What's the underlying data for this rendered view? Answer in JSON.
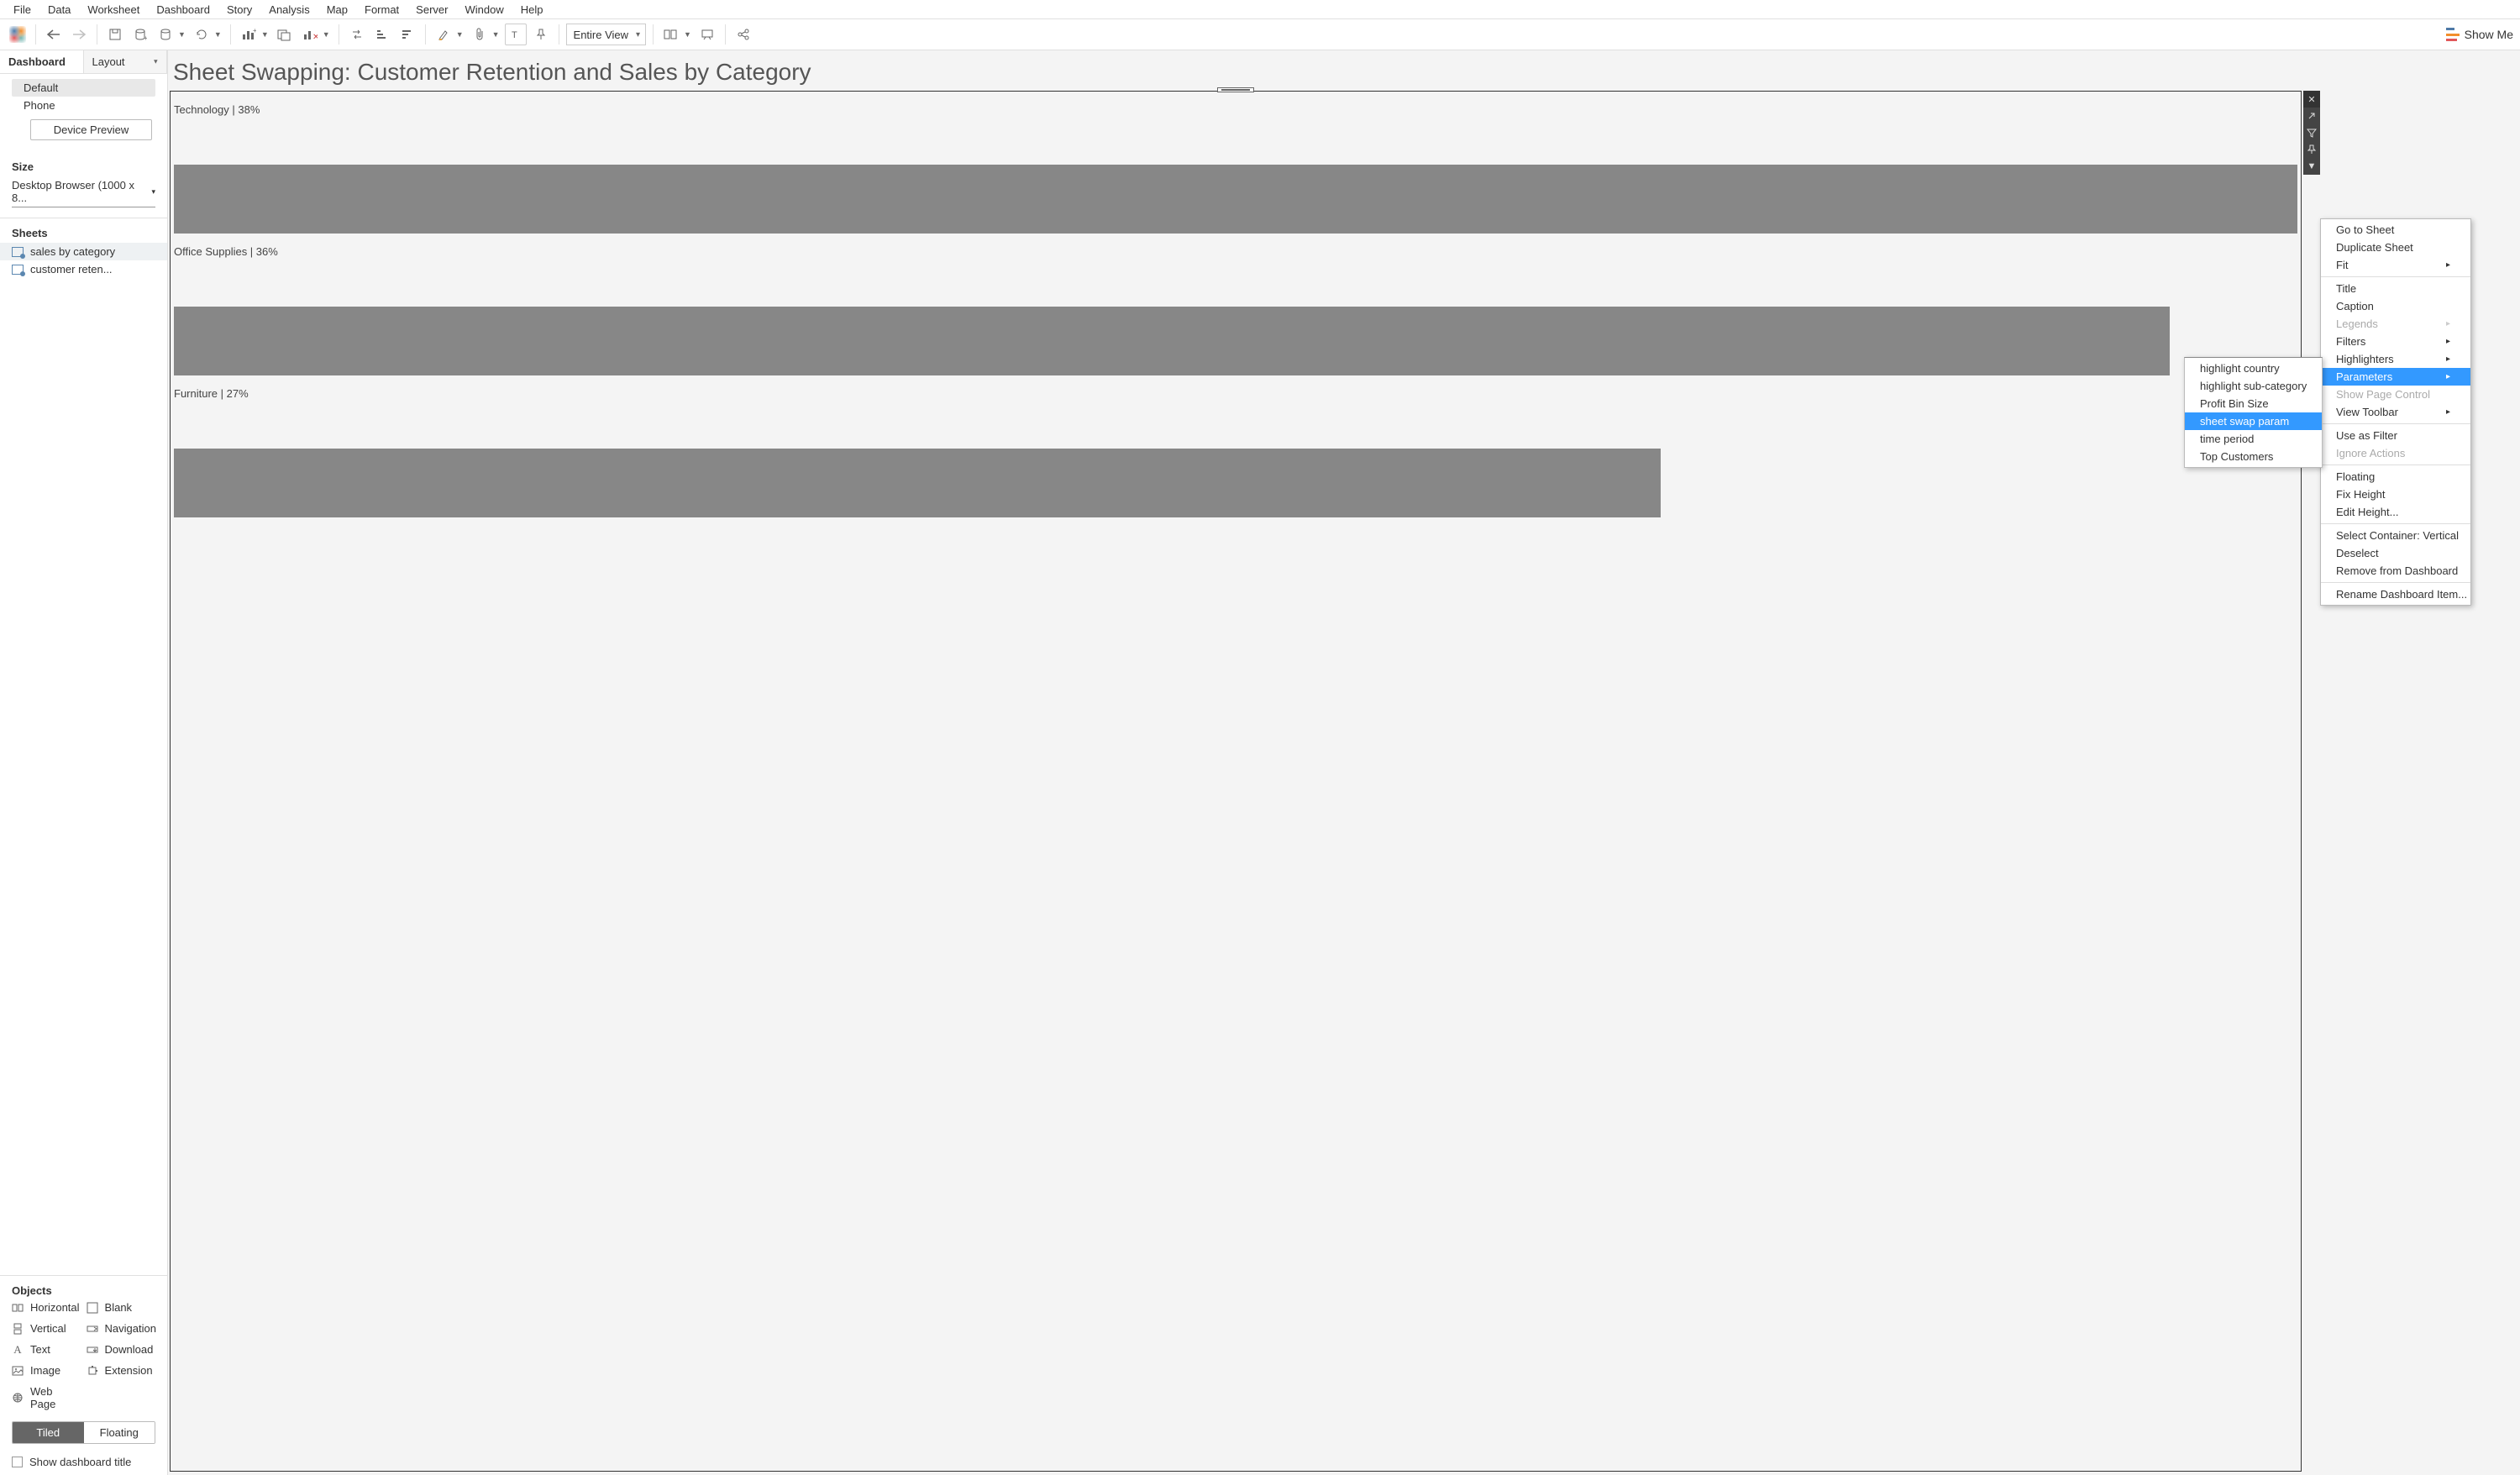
{
  "menu": [
    "File",
    "Data",
    "Worksheet",
    "Dashboard",
    "Story",
    "Analysis",
    "Map",
    "Format",
    "Server",
    "Window",
    "Help"
  ],
  "toolbar": {
    "fit_select": "Entire View",
    "showme": "Show Me"
  },
  "sidebar": {
    "tabs": {
      "dashboard": "Dashboard",
      "layout": "Layout"
    },
    "devices": {
      "default": "Default",
      "phone": "Phone",
      "preview_btn": "Device Preview"
    },
    "size": {
      "label": "Size",
      "value": "Desktop Browser (1000 x 8..."
    },
    "sheets": {
      "label": "Sheets",
      "items": [
        "sales by category",
        "customer reten..."
      ]
    },
    "objects": {
      "label": "Objects",
      "items": [
        "Horizontal",
        "Blank",
        "Vertical",
        "Navigation",
        "Text",
        "Download",
        "Image",
        "Extension",
        "Web Page"
      ]
    },
    "tile": {
      "tiled": "Tiled",
      "floating": "Floating"
    },
    "show_title": "Show dashboard title"
  },
  "canvas": {
    "title": "Sheet Swapping: Customer Retention and Sales by Category",
    "bars": [
      {
        "label": "Technology | 38%",
        "width": 100
      },
      {
        "label": "Office Supplies | 36%",
        "width": 94
      },
      {
        "label": "Furniture | 27%",
        "width": 70
      }
    ]
  },
  "chart_data": {
    "type": "bar",
    "title": "Sheet Swapping: Customer Retention and Sales by Category",
    "categories": [
      "Technology",
      "Office Supplies",
      "Furniture"
    ],
    "values": [
      38,
      36,
      27
    ],
    "unit": "%",
    "orientation": "horizontal"
  },
  "context_menu": {
    "items": [
      {
        "label": "Go to Sheet"
      },
      {
        "label": "Duplicate Sheet"
      },
      {
        "label": "Fit",
        "arrow": true
      },
      {
        "sep": true
      },
      {
        "label": "Title"
      },
      {
        "label": "Caption"
      },
      {
        "label": "Legends",
        "arrow": true,
        "disabled": true
      },
      {
        "label": "Filters",
        "arrow": true
      },
      {
        "label": "Highlighters",
        "arrow": true
      },
      {
        "label": "Parameters",
        "arrow": true,
        "highlight": true
      },
      {
        "label": "Show Page Control",
        "disabled": true
      },
      {
        "label": "View Toolbar",
        "arrow": true
      },
      {
        "sep": true
      },
      {
        "label": "Use as Filter"
      },
      {
        "label": "Ignore Actions",
        "disabled": true
      },
      {
        "sep": true
      },
      {
        "label": "Floating"
      },
      {
        "label": "Fix Height"
      },
      {
        "label": "Edit Height..."
      },
      {
        "sep": true
      },
      {
        "label": "Select Container: Vertical"
      },
      {
        "label": "Deselect"
      },
      {
        "label": "Remove from Dashboard"
      },
      {
        "sep": true
      },
      {
        "label": "Rename Dashboard Item..."
      }
    ]
  },
  "sub_menu": {
    "items": [
      {
        "label": "highlight country"
      },
      {
        "label": "highlight sub-category"
      },
      {
        "label": "Profit Bin Size"
      },
      {
        "label": "sheet swap param",
        "highlight": true
      },
      {
        "label": "time period"
      },
      {
        "label": "Top Customers"
      }
    ]
  }
}
